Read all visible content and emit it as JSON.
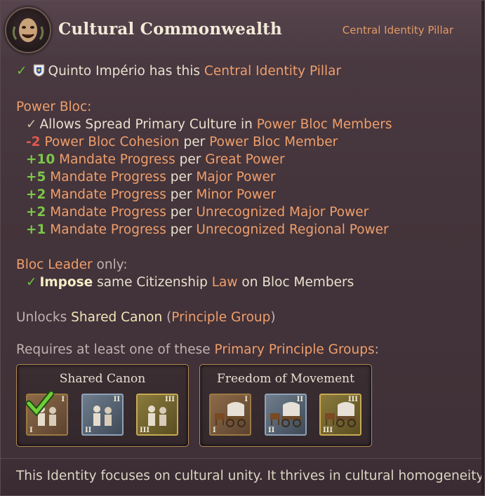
{
  "header": {
    "title": "Cultural Commonwealth",
    "category": "Central Identity Pillar",
    "emblem_icon": "theater-mask-icon"
  },
  "ownership": {
    "country": "Quinto Império",
    "text": "has this",
    "link": "Central Identity Pillar"
  },
  "power_bloc": {
    "heading": "Power Bloc:",
    "allows": {
      "prefix": "Allows Spread Primary Culture in",
      "link": "Power Bloc Members"
    },
    "effects": [
      {
        "value": "-2",
        "label": "Power Bloc Cohesion",
        "per": "per",
        "target": "Power Bloc Member",
        "sign": "negative"
      },
      {
        "value": "+10",
        "label": "Mandate Progress",
        "per": "per",
        "target": "Great Power",
        "sign": "positive"
      },
      {
        "value": "+5",
        "label": "Mandate Progress",
        "per": "per",
        "target": "Major Power",
        "sign": "positive"
      },
      {
        "value": "+2",
        "label": "Mandate Progress",
        "per": "per",
        "target": "Minor Power",
        "sign": "positive"
      },
      {
        "value": "+2",
        "label": "Mandate Progress",
        "per": "per",
        "target": "Unrecognized Major Power",
        "sign": "positive"
      },
      {
        "value": "+1",
        "label": "Mandate Progress",
        "per": "per",
        "target": "Unrecognized Regional Power",
        "sign": "positive"
      }
    ]
  },
  "bloc_leader": {
    "heading_link": "Bloc Leader",
    "heading_suffix": "only:",
    "impose": "Impose",
    "mid": "same Citizenship",
    "law": "Law",
    "end": "on Bloc Members"
  },
  "unlocks": {
    "prefix": "Unlocks",
    "item": "Shared Canon",
    "open": "(",
    "group": "Principle Group",
    "close": ")"
  },
  "requires": {
    "prefix": "Requires at least one of these",
    "link": "Primary Principle Groups",
    "suffix": ":"
  },
  "groups": [
    {
      "name": "Shared Canon",
      "principles": [
        {
          "tier": "I",
          "icon": "scholars-icon",
          "selected": true
        },
        {
          "tier": "II",
          "icon": "scholars-icon",
          "selected": false
        },
        {
          "tier": "III",
          "icon": "scholars-icon",
          "selected": false
        }
      ]
    },
    {
      "name": "Freedom of Movement",
      "principles": [
        {
          "tier": "I",
          "icon": "covered-wagon-icon",
          "selected": false
        },
        {
          "tier": "II",
          "icon": "covered-wagon-icon",
          "selected": false
        },
        {
          "tier": "III",
          "icon": "covered-wagon-icon",
          "selected": false
        }
      ]
    }
  ],
  "footer": {
    "description": "This Identity focuses on cultural unity. It thrives in cultural homogeneity."
  },
  "colors": {
    "highlight": "#ef9f6b",
    "positive": "#7cc74a",
    "negative": "#e0584e",
    "text": "#e9e2cf"
  }
}
